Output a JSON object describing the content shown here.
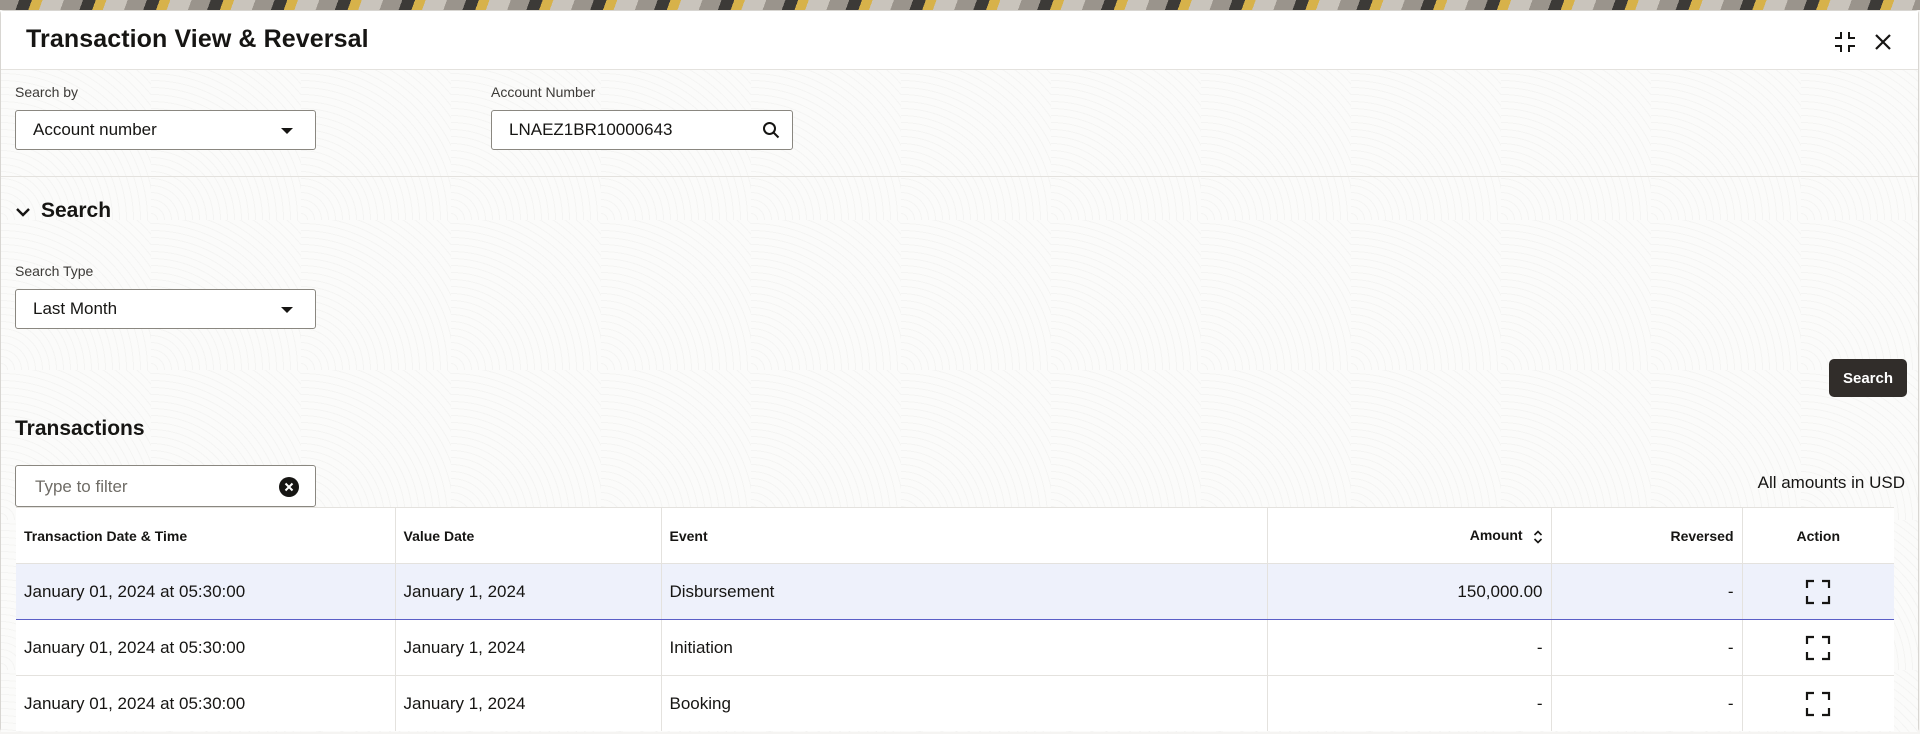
{
  "dialog": {
    "title": "Transaction View & Reversal",
    "icons": {
      "collapse": "collapse-icon",
      "close": "close-icon"
    }
  },
  "search_bar": {
    "search_by_label": "Search by",
    "search_by_value": "Account number",
    "account_number_label": "Account Number",
    "account_number_value": "LNAEZ1BR10000643"
  },
  "search_section": {
    "title": "Search",
    "search_type_label": "Search Type",
    "search_type_value": "Last Month",
    "search_button": "Search"
  },
  "transactions": {
    "title": "Transactions",
    "filter_placeholder": "Type to filter",
    "amounts_note": "All amounts in USD",
    "columns": [
      "Transaction Date & Time",
      "Value Date",
      "Event",
      "Amount",
      "Reversed",
      "Action"
    ],
    "rows": [
      {
        "datetime": "January 01, 2024 at 05:30:00",
        "value_date": "January 1, 2024",
        "event": "Disbursement",
        "amount": "150,000.00",
        "reversed": "-"
      },
      {
        "datetime": "January 01, 2024 at 05:30:00",
        "value_date": "January 1, 2024",
        "event": "Initiation",
        "amount": "-",
        "reversed": "-"
      },
      {
        "datetime": "January 01, 2024 at 05:30:00",
        "value_date": "January 1, 2024",
        "event": "Booking",
        "amount": "-",
        "reversed": "-"
      }
    ]
  },
  "colors": {
    "primary_button": "#312d2a",
    "selected_row": "#eef1fb",
    "selected_border": "#5b5fc7"
  }
}
